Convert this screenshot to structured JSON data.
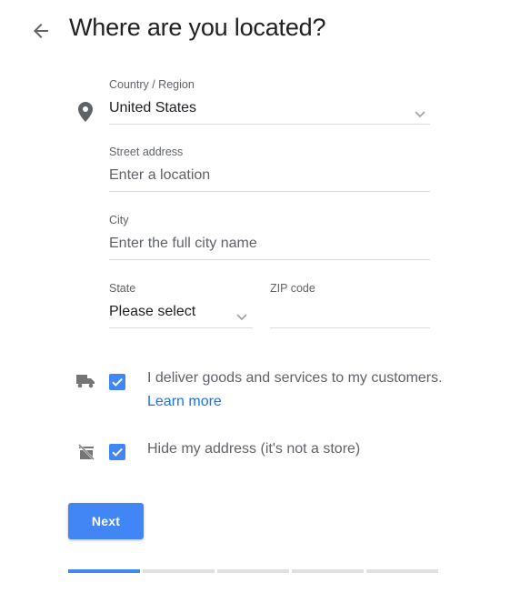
{
  "header": {
    "title": "Where are you located?",
    "back_icon": "arrow-left-icon"
  },
  "country": {
    "label": "Country / Region",
    "value": "United States",
    "icon": "location-pin-icon"
  },
  "street": {
    "label": "Street address",
    "placeholder": "Enter a location"
  },
  "city": {
    "label": "City",
    "placeholder": "Enter the full city name"
  },
  "state": {
    "label": "State",
    "value": "Please select"
  },
  "zip": {
    "label": "ZIP code",
    "value": ""
  },
  "options": {
    "deliver": {
      "icon": "delivery-truck-icon",
      "checked": true,
      "text": "I deliver goods and services to my customers.",
      "link": "Learn more"
    },
    "hide_address": {
      "icon": "store-off-icon",
      "checked": true,
      "text": "Hide my address (it's not a store)"
    }
  },
  "next_button": {
    "label": "Next"
  },
  "progress": {
    "steps": 5,
    "current": 1
  },
  "colors": {
    "accent": "#4285f4",
    "link": "#1a73e8",
    "text": "#202124",
    "muted": "#5f6368",
    "divider": "#dadce0"
  }
}
